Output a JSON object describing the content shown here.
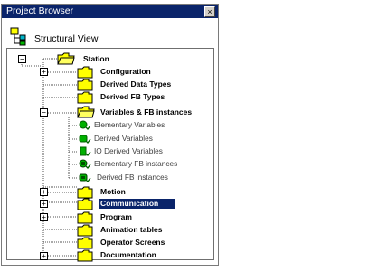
{
  "window": {
    "title": "Project Browser",
    "close_glyph": "×"
  },
  "header": {
    "label": "Structural View",
    "icon": "structural-view-icon"
  },
  "tree": {
    "root": "Station",
    "items": [
      "Configuration",
      "Derived Data Types",
      "Derived FB Types",
      "Variables & FB instances",
      "Motion",
      "Communication",
      "Program",
      "Animation tables",
      "Operator Screens",
      "Documentation"
    ],
    "sub_items": [
      "Elementary Variables",
      "Derived Variables",
      "IO Derived Variables",
      "Elementary FB instances",
      "Derived FB instances"
    ],
    "selected": "Communication"
  },
  "expanders": {
    "collapsed": "+",
    "expanded": "−"
  },
  "colors": {
    "selection": "#0a246a",
    "titlebar": "#0a246a",
    "folder": "#ffff00",
    "variable_icon": "#00a000"
  }
}
